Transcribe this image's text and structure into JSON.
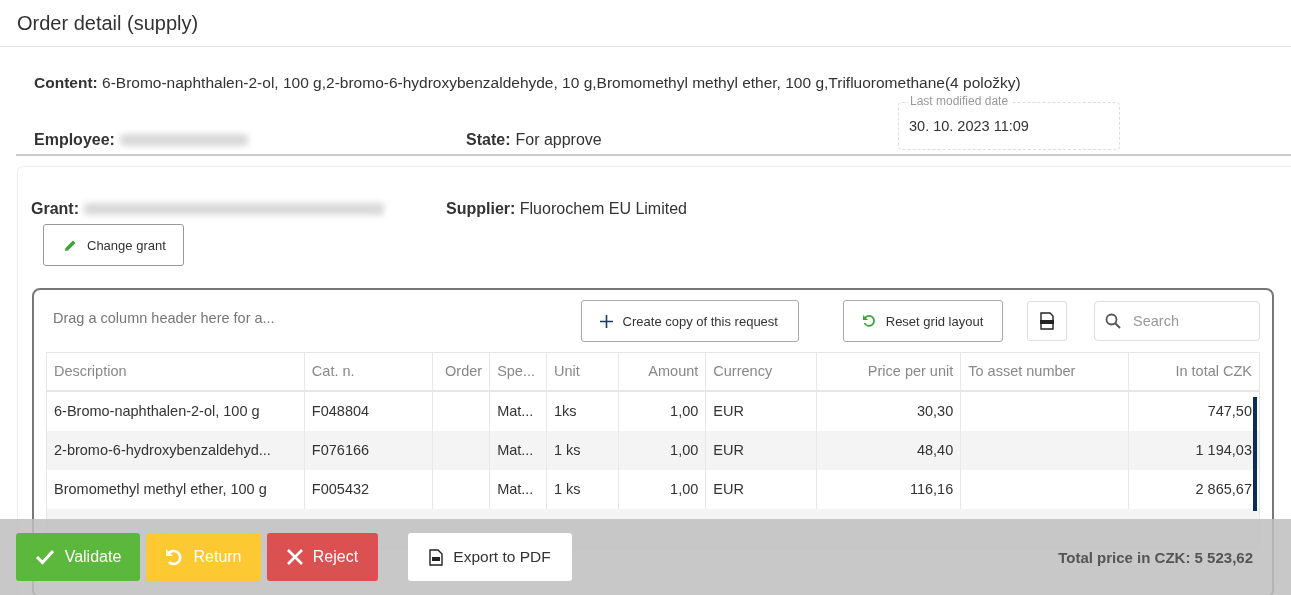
{
  "page": {
    "title": "Order detail (supply)"
  },
  "content": {
    "label": "Content:",
    "value": "6-Bromo-naphthalen-2-ol, 100 g,2-bromo-6-hydroxybenzaldehyde, 10 g,Bromomethyl methyl ether, 100 g,Trifluoromethane(4 položky)"
  },
  "employee": {
    "label": "Employee:"
  },
  "state": {
    "label": "State:",
    "value": "For approve"
  },
  "last_modified": {
    "label": "Last modified date",
    "value": "30. 10. 2023 11:09"
  },
  "grant": {
    "label": "Grant:"
  },
  "supplier": {
    "label": "Supplier:",
    "value": "Fluorochem EU Limited"
  },
  "change_grant_button": "Change grant",
  "grid": {
    "group_panel": "Drag a column header here for a...",
    "copy_button": "Create copy of this request",
    "reset_button": "Reset grid layout",
    "search": {
      "placeholder": "Search"
    },
    "columns": [
      {
        "label": "Description"
      },
      {
        "label": "Cat. n."
      },
      {
        "label": "Order"
      },
      {
        "label": "Spe..."
      },
      {
        "label": "Unit"
      },
      {
        "label": "Amount"
      },
      {
        "label": "Currency"
      },
      {
        "label": "Price per unit"
      },
      {
        "label": "To asset number"
      },
      {
        "label": "In total CZK"
      }
    ],
    "rows": [
      {
        "cells": [
          "6-Bromo-naphthalen-2-ol, 100 g",
          "F048804",
          "",
          "Mat...",
          "1ks",
          "1,00",
          "EUR",
          "30,30",
          "",
          "747,50"
        ]
      },
      {
        "cells": [
          "2-bromo-6-hydroxybenzaldehyd...",
          "F076166",
          "",
          "Mat...",
          "1 ks",
          "1,00",
          "EUR",
          "48,40",
          "",
          "1 194,03"
        ]
      },
      {
        "cells": [
          "Bromomethyl methyl ether, 100 g",
          "F005432",
          "",
          "Mat...",
          "1 ks",
          "1,00",
          "EUR",
          "116,16",
          "",
          "2 865,67"
        ]
      }
    ],
    "total": "Total price in CZK: 5 523,62"
  },
  "actions": [
    {
      "label": "Validate",
      "kind": "validate"
    },
    {
      "label": "Return",
      "kind": "return"
    },
    {
      "label": "Reject",
      "kind": "reject"
    },
    {
      "label": "Export to PDF",
      "kind": "export"
    }
  ]
}
